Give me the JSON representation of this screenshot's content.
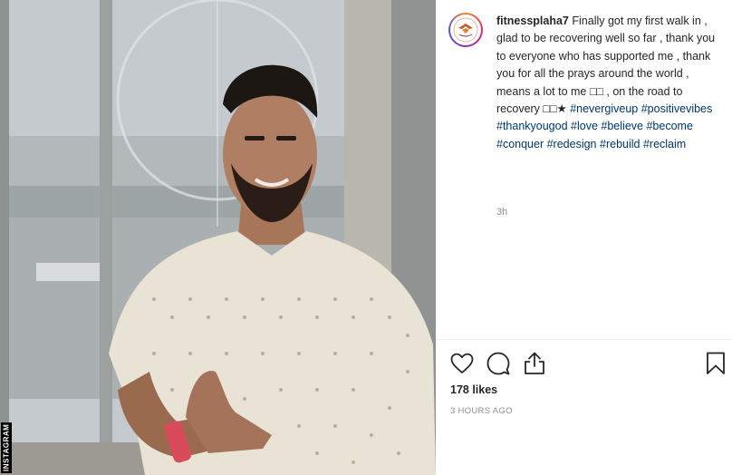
{
  "post": {
    "username": "fitnessplaha7",
    "caption_parts": [
      "Finally got my first walk in , glad to be recovering well so far , thank you to everyone who has supported me , thank you for all the prays around the world , means a lot to me □□ , on the road to recovery □□★ "
    ],
    "hashtags": [
      "#nevergiveup",
      "#positivevibes",
      "#thankyougod",
      "#love",
      "#believe",
      "#become",
      "#conquer",
      "#redesign",
      "#rebuild",
      "#reclaim"
    ],
    "time_short": "3h",
    "likes": "178 likes",
    "time_long": "3 HOURS AGO"
  },
  "watermark": "INSTAGRAM",
  "icons": {
    "like": "heart-icon",
    "comment": "comment-icon",
    "share": "share-icon",
    "save": "bookmark-icon"
  },
  "colors": {
    "hashtag": "#00376b",
    "muted": "#8e8e8e",
    "text": "#262626"
  }
}
